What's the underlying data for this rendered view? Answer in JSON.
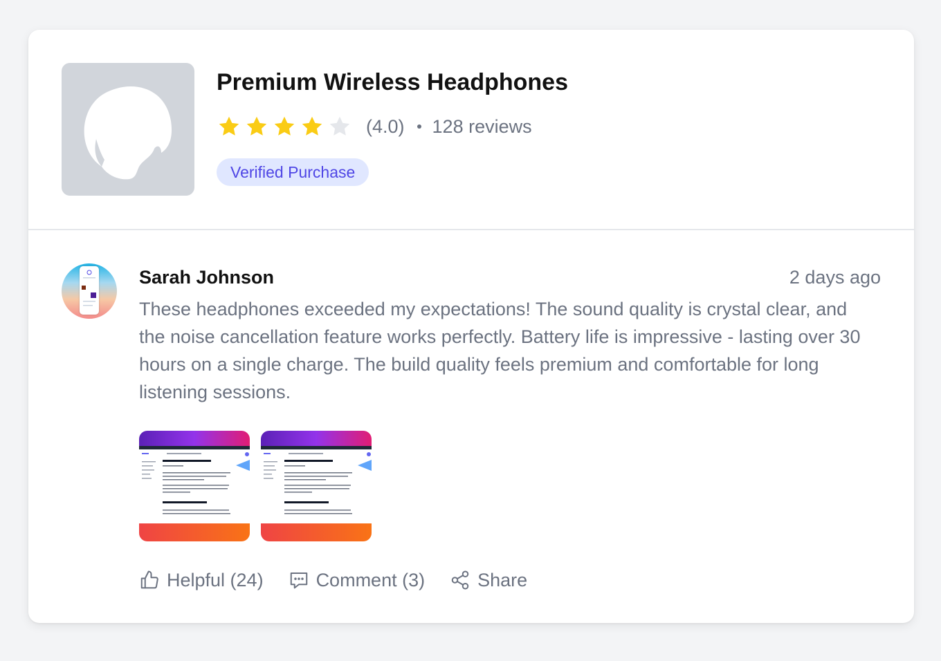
{
  "product": {
    "title": "Premium Wireless Headphones",
    "rating": 4.0,
    "rating_display": "(4.0)",
    "stars_filled": 4,
    "stars_total": 5,
    "review_count": "128 reviews",
    "badge": "Verified Purchase"
  },
  "review": {
    "reviewer_name": "Sarah Johnson",
    "date": "2 days ago",
    "text": "These headphones exceeded my expectations! The sound quality is crystal clear, and the noise cancellation feature works perfectly. Battery life is impressive - lasting over 30 hours on a single charge. The build quality feels premium and comfortable for long listening sessions.",
    "images_count": 2,
    "actions": {
      "helpful": "Helpful (24)",
      "comment": "Comment (3)",
      "share": "Share"
    }
  },
  "colors": {
    "star_filled": "#facc15",
    "star_empty": "#e5e7eb",
    "badge_bg": "#e0e7ff",
    "badge_text": "#4f46e5",
    "muted_text": "#6b7280"
  },
  "icons": {
    "product_placeholder": "image-placeholder-icon",
    "star": "star-icon",
    "helpful": "thumbs-up-icon",
    "comment": "comment-icon",
    "share": "share-icon"
  }
}
